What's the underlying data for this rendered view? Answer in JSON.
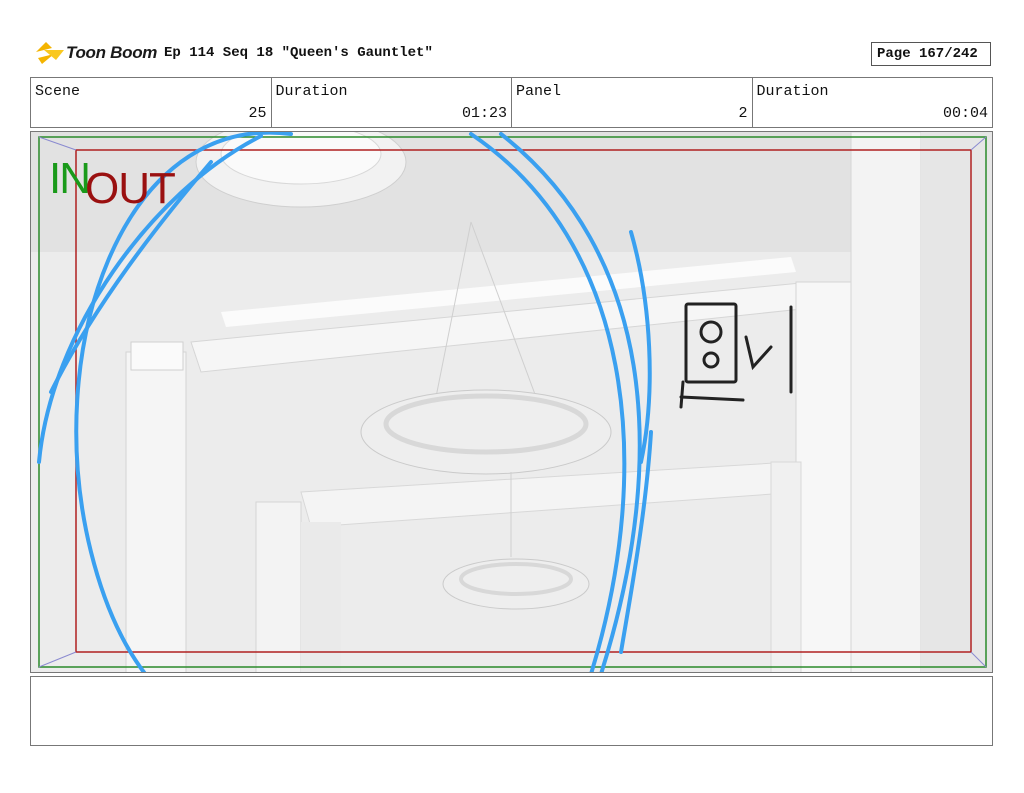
{
  "header": {
    "logo_text": "Toon Boom",
    "title": "Ep 114 Seq 18 \"Queen's Gauntlet\"",
    "page": "Page 167/242"
  },
  "info": [
    {
      "label": "Scene",
      "value": "25"
    },
    {
      "label": "Duration",
      "value": "01:23"
    },
    {
      "label": "Panel",
      "value": "2"
    },
    {
      "label": "Duration",
      "value": "00:04"
    }
  ],
  "panel": {
    "in_label": "IN",
    "out_label": "OUT",
    "colors": {
      "in_frame": "#2a8a2a",
      "out_frame": "#b02020",
      "camera_stroke": "#3aa0f0"
    }
  },
  "notes": {
    "text": ""
  }
}
